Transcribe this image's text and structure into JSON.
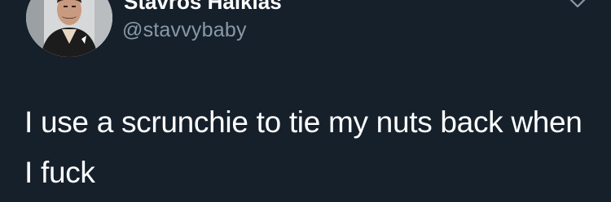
{
  "user": {
    "display_name": "Stavros Halkias",
    "handle": "@stavvybaby"
  },
  "tweet": {
    "text": "I use a scrunchie to tie my nuts back when I fuck"
  },
  "icons": {
    "avatar": "profile-photo",
    "menu": "chevron-down-icon"
  },
  "colors": {
    "background": "#16202b",
    "text": "#ffffff",
    "secondary_text": "#8899a6"
  }
}
